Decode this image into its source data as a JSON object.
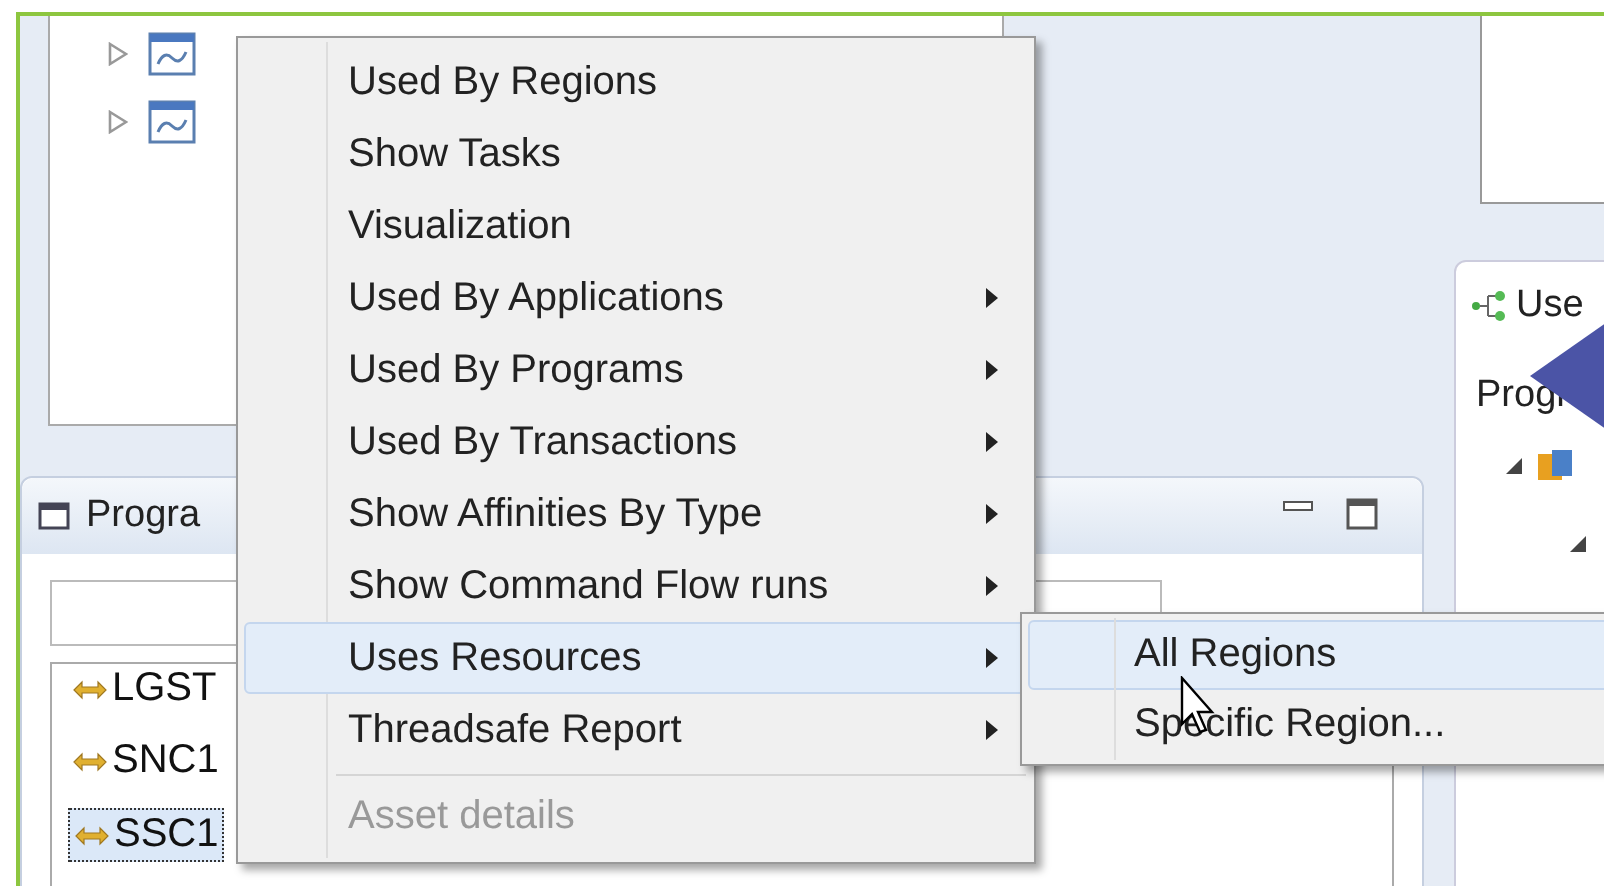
{
  "tree": {
    "items": [
      {
        "expanded": false
      },
      {
        "expanded": false
      }
    ]
  },
  "programs_panel": {
    "title": "Progra",
    "items": [
      {
        "label": "LGST",
        "selected": false
      },
      {
        "label": "SNC1",
        "selected": false
      },
      {
        "label": "SSC1",
        "selected": true
      }
    ]
  },
  "uses_panel": {
    "title": "Use",
    "label": "Progr"
  },
  "context_menu": {
    "items": [
      {
        "label": "Used By Regions",
        "has_submenu": false,
        "disabled": false,
        "selected": false,
        "separator_before": false
      },
      {
        "label": "Show Tasks",
        "has_submenu": false,
        "disabled": false,
        "selected": false,
        "separator_before": false
      },
      {
        "label": "Visualization",
        "has_submenu": false,
        "disabled": false,
        "selected": false,
        "separator_before": false
      },
      {
        "label": "Used By Applications",
        "has_submenu": true,
        "disabled": false,
        "selected": false,
        "separator_before": false
      },
      {
        "label": "Used By Programs",
        "has_submenu": true,
        "disabled": false,
        "selected": false,
        "separator_before": false
      },
      {
        "label": "Used By Transactions",
        "has_submenu": true,
        "disabled": false,
        "selected": false,
        "separator_before": false
      },
      {
        "label": "Show Affinities By Type",
        "has_submenu": true,
        "disabled": false,
        "selected": false,
        "separator_before": false
      },
      {
        "label": "Show Command Flow runs",
        "has_submenu": true,
        "disabled": false,
        "selected": false,
        "separator_before": false
      },
      {
        "label": "Uses Resources",
        "has_submenu": true,
        "disabled": false,
        "selected": true,
        "separator_before": false
      },
      {
        "label": "Threadsafe Report",
        "has_submenu": true,
        "disabled": false,
        "selected": false,
        "separator_before": false
      },
      {
        "label": "Asset details",
        "has_submenu": false,
        "disabled": true,
        "selected": false,
        "separator_before": true
      }
    ]
  },
  "submenu": {
    "items": [
      {
        "label": "All Regions",
        "selected": true
      },
      {
        "label": "Specific Region...",
        "selected": false
      }
    ]
  }
}
